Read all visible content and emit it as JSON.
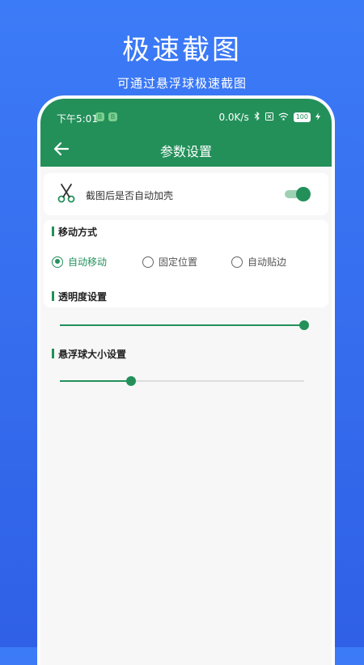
{
  "promo": {
    "title": "极速截图",
    "subtitle": "可通过悬浮球极速截图"
  },
  "statusbar": {
    "time": "下午5:01",
    "badge_a": "B",
    "badge_b": "B",
    "net_speed": "0.0K/s",
    "battery": "100"
  },
  "appbar": {
    "title": "参数设置",
    "back_icon": "arrow-left-icon"
  },
  "auto_shell": {
    "icon": "scissors-icon",
    "label": "截图后是否自动加壳",
    "enabled": true
  },
  "move_mode": {
    "title": "移动方式",
    "options": [
      "自动移动",
      "固定位置",
      "自动贴边"
    ],
    "selected": "自动移动"
  },
  "opacity": {
    "title": "透明度设置",
    "value": 1.0
  },
  "ball_size": {
    "title": "悬浮球大小设置",
    "value": 0.29
  },
  "colors": {
    "accent": "#23905a",
    "background": "#3c7bf7"
  }
}
